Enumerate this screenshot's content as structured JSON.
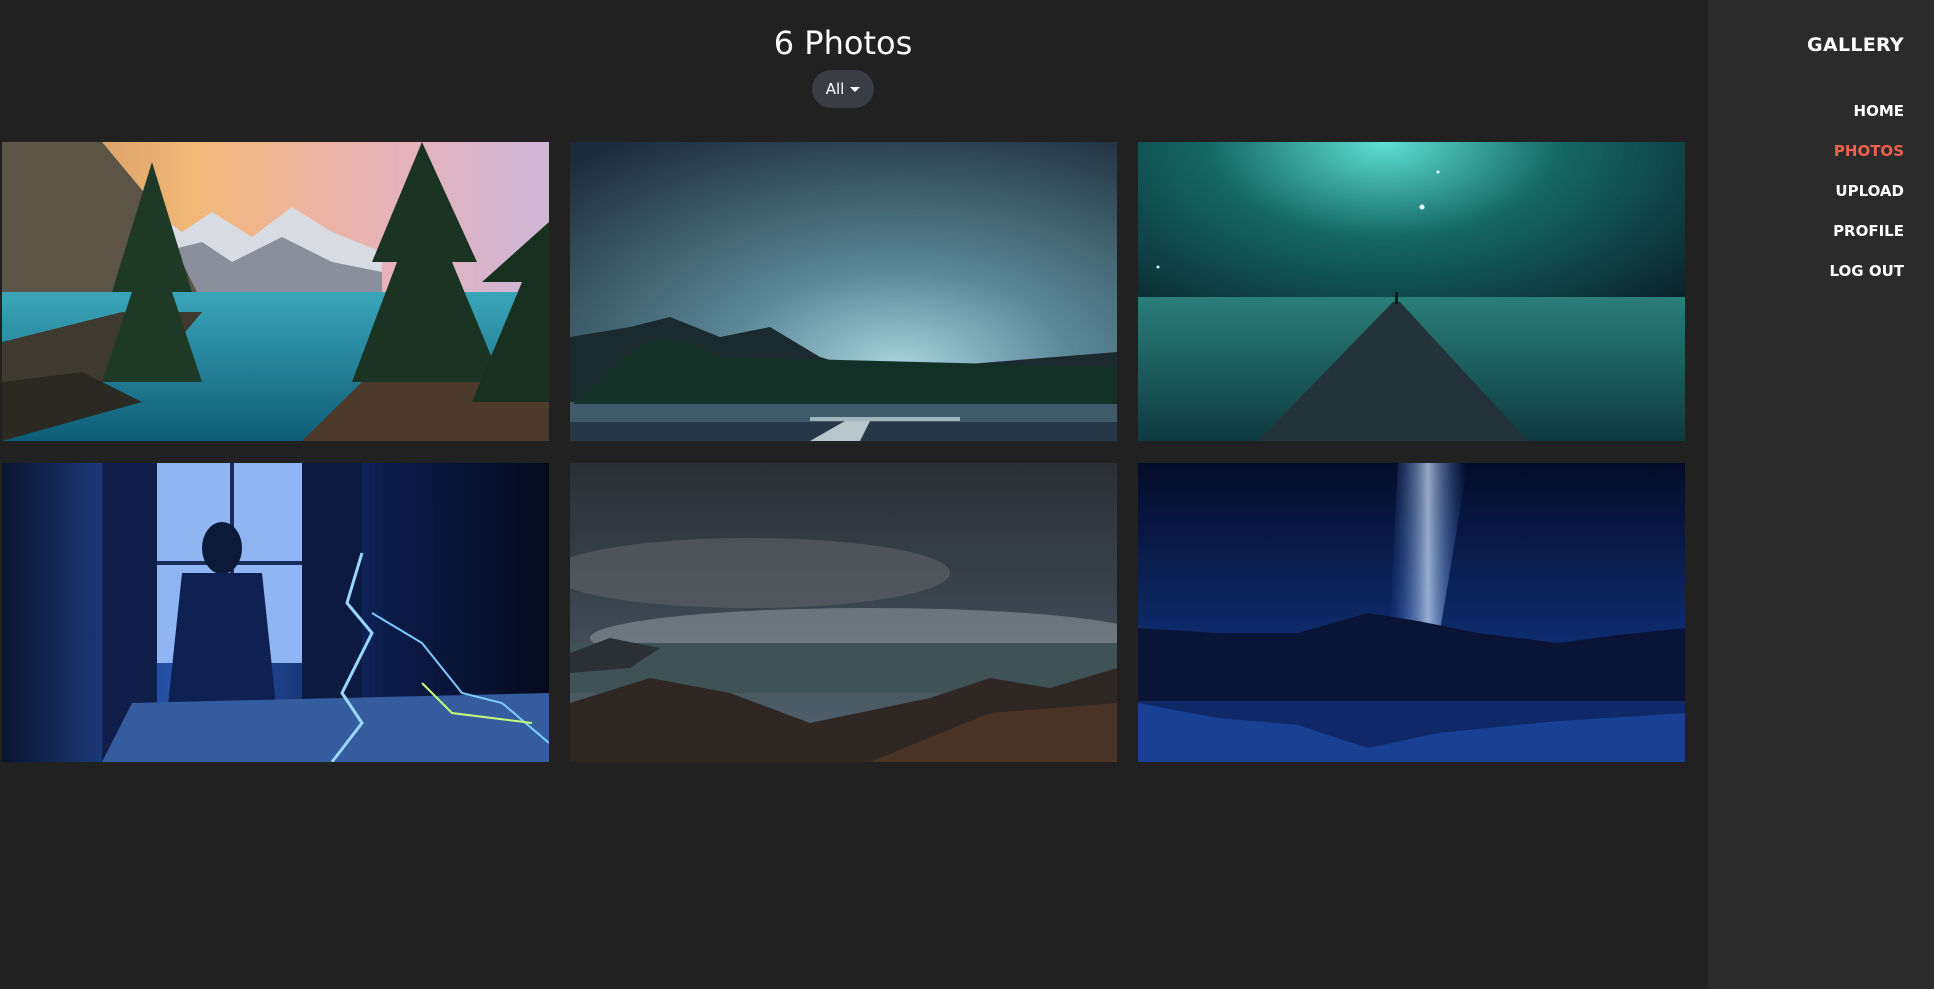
{
  "header": {
    "title": "6 Photos",
    "filter_label": "All"
  },
  "sidebar": {
    "brand": "GALLERY",
    "items": [
      {
        "label": "HOME",
        "active": false
      },
      {
        "label": "PHOTOS",
        "active": true
      },
      {
        "label": "UPLOAD",
        "active": false
      },
      {
        "label": "PROFILE",
        "active": false
      },
      {
        "label": "LOG OUT",
        "active": false
      }
    ],
    "active_color": "#f0624d"
  },
  "photos": [
    {
      "subject": "mountain lake with pine trees at sunset"
    },
    {
      "subject": "night sky over forest lake with pier"
    },
    {
      "subject": "teal starry sky with stone pier and figure"
    },
    {
      "subject": "girl at window with blue lightning"
    },
    {
      "subject": "starry sky over clouds and mountains"
    },
    {
      "subject": "milky way over mountain lake reflection"
    }
  ],
  "colors": {
    "background": "#212121",
    "sidebar": "#2b2b2b",
    "filter_pill": "#3a3d44"
  }
}
